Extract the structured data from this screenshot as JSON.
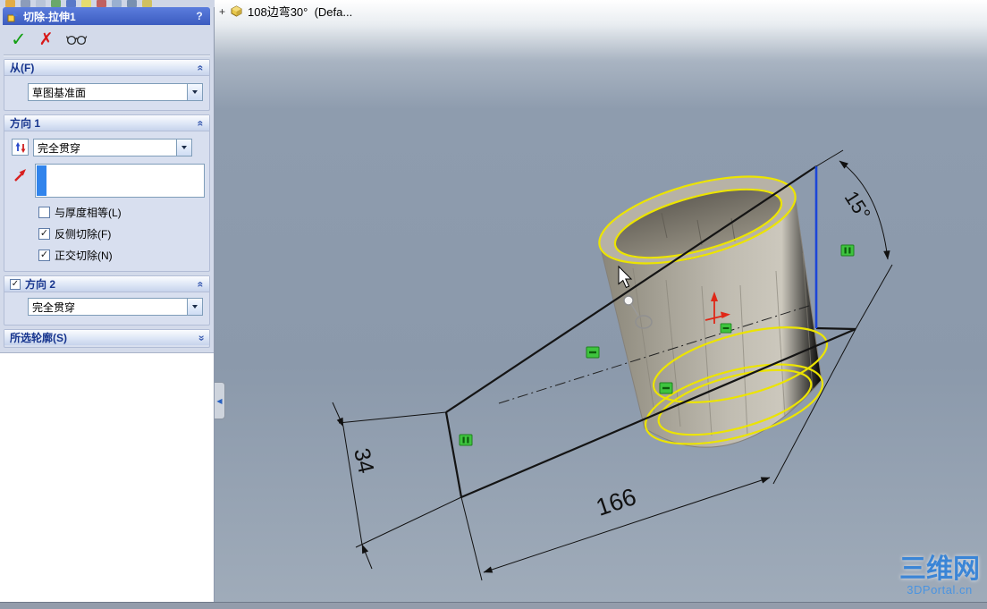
{
  "icons": {
    "help": "?",
    "ok": "✓",
    "cancel": "✗",
    "chevron_double": "«",
    "checkmark": "✓",
    "collapse_tab": "◀",
    "tree_expand": "+"
  },
  "panel": {
    "title": "切除-拉伸1",
    "from": {
      "label": "从(F)",
      "value": "草图基准面"
    },
    "direction1": {
      "label": "方向 1",
      "value": "完全贯穿",
      "options": [
        {
          "label": "与厚度相等(L)",
          "checked": false
        },
        {
          "label": "反侧切除(F)",
          "checked": true
        },
        {
          "label": "正交切除(N)",
          "checked": true
        }
      ]
    },
    "direction2": {
      "label": "方向 2",
      "value": "完全贯穿",
      "checked": true
    },
    "contours": {
      "label": "所选轮廓(S)"
    }
  },
  "viewport": {
    "feature_tree_item": "108边弯30°  (Defa...",
    "dimensions": {
      "angle": "15°",
      "height": "34",
      "length": "166"
    },
    "watermark": {
      "line1": "三维网",
      "line2": "3DPortal.cn"
    }
  },
  "colors": {
    "highlight_edge": "#ece400",
    "selected_line": "#1c46d8",
    "sketch_line": "#141414",
    "constraint_green": "#3ec43e",
    "origin_red": "#e02818",
    "selection_strip": "#3184ec"
  }
}
